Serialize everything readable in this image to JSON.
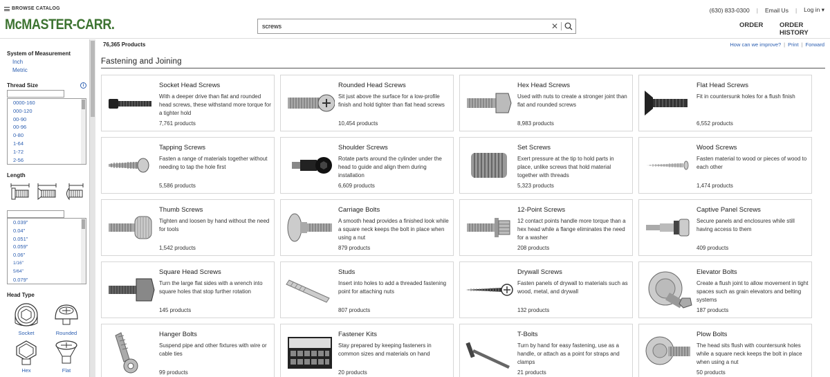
{
  "header": {
    "browse": "BROWSE CATALOG",
    "logo": "McMASTER-CARR.",
    "search_value": "screws",
    "phone": "(630) 833-0300",
    "email": "Email Us",
    "login": "Log in",
    "order": "ORDER",
    "order_history": "ORDER HISTORY"
  },
  "sidebar": {
    "measure_title": "System of Measurement",
    "inch": "Inch",
    "metric": "Metric",
    "thread_title": "Thread Size",
    "thread_sizes": [
      "0000-160",
      "000-120",
      "00-90",
      "00-96",
      "0-80",
      "1-64",
      "1-72",
      "2-56"
    ],
    "length_title": "Length",
    "lengths": [
      "0.039\"",
      "0.04\"",
      "0.051\"",
      "0.059\"",
      "0.06\"",
      "1/16\"",
      "5/64\"",
      "0.079\""
    ],
    "head_title": "Head Type",
    "head_types": [
      "Socket",
      "Rounded",
      "Hex",
      "Flat"
    ]
  },
  "main": {
    "count": "76,365 Products",
    "improve": "How can we improve?",
    "print": "Print",
    "forward": "Forward",
    "section": "Fastening and Joining",
    "cards": [
      {
        "title": "Socket Head Screws",
        "desc": "With a deeper drive than flat and rounded head screws, these withstand more torque for a tighter hold",
        "count": "7,761 products",
        "icon": "socket-screw"
      },
      {
        "title": "Rounded Head Screws",
        "desc": "Sit just above the surface for a low-profile finish and hold tighter than flat head screws",
        "count": "10,454 products",
        "icon": "rounded-screw"
      },
      {
        "title": "Hex Head Screws",
        "desc": "Used with nuts to create a stronger joint than flat and rounded screws",
        "count": "8,983 products",
        "icon": "hex-screw"
      },
      {
        "title": "Flat Head Screws",
        "desc": "Fit in countersunk holes for a flush finish",
        "count": "6,552 products",
        "icon": "flat-screw"
      },
      {
        "title": "Tapping Screws",
        "desc": "Fasten a range of materials together without needing to tap the hole first",
        "count": "5,586 products",
        "icon": "tapping-screw"
      },
      {
        "title": "Shoulder Screws",
        "desc": "Rotate parts around the cylinder under the head to guide and align them during installation",
        "count": "6,609 products",
        "icon": "shoulder-screw"
      },
      {
        "title": "Set Screws",
        "desc": "Exert pressure at the tip to hold parts in place, unlike screws that hold material together with threads",
        "count": "5,323 products",
        "icon": "set-screw"
      },
      {
        "title": "Wood Screws",
        "desc": "Fasten material to wood or pieces of wood to each other",
        "count": "1,474 products",
        "icon": "wood-screw"
      },
      {
        "title": "Thumb Screws",
        "desc": "Tighten and loosen by hand without the need for tools",
        "count": "1,542 products",
        "icon": "thumb-screw"
      },
      {
        "title": "Carriage Bolts",
        "desc": "A smooth head provides a finished look while a square neck keeps the bolt in place when using a nut",
        "count": "879 products",
        "icon": "carriage-bolt"
      },
      {
        "title": "12-Point Screws",
        "desc": "12 contact points handle more torque than a hex head while a flange eliminates the need for a washer",
        "count": "208 products",
        "icon": "12-point-screw"
      },
      {
        "title": "Captive Panel Screws",
        "desc": "Secure panels and enclosures while still having access to them",
        "count": "409 products",
        "icon": "captive-panel-screw"
      },
      {
        "title": "Square Head Screws",
        "desc": "Turn the large flat sides with a wrench into square holes that stop further rotation",
        "count": "145 products",
        "icon": "square-head-screw"
      },
      {
        "title": "Studs",
        "desc": "Insert into holes to add a threaded fastening point for attaching nuts",
        "count": "807 products",
        "icon": "stud"
      },
      {
        "title": "Drywall Screws",
        "desc": "Fasten panels of drywall to materials such as wood, metal, and drywall",
        "count": "132 products",
        "icon": "drywall-screw"
      },
      {
        "title": "Elevator Bolts",
        "desc": "Create a flush joint to allow movement in tight spaces such as grain elevators and belting systems",
        "count": "187 products",
        "icon": "elevator-bolt"
      },
      {
        "title": "Hanger Bolts",
        "desc": "Suspend pipe and other fixtures with wire or cable ties",
        "count": "99 products",
        "icon": "hanger-bolt"
      },
      {
        "title": "Fastener Kits",
        "desc": "Stay prepared by keeping fasteners in common sizes and materials on hand",
        "count": "20 products",
        "icon": "fastener-kit"
      },
      {
        "title": "T-Bolts",
        "desc": "Turn by hand for easy fastening, use as a handle, or attach as a point for straps and clamps",
        "count": "21 products",
        "icon": "t-bolt"
      },
      {
        "title": "Plow Bolts",
        "desc": "The head sits flush with countersunk holes while a square neck keeps the bolt in place when using a nut",
        "count": "50 products",
        "icon": "plow-bolt"
      }
    ]
  }
}
